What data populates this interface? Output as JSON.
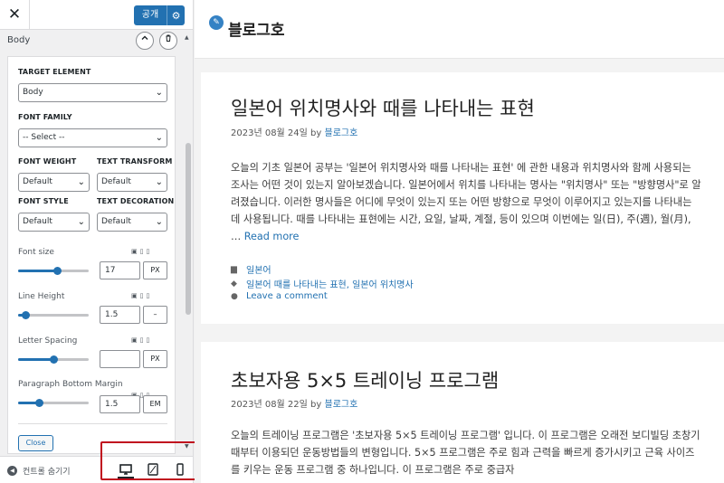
{
  "sidebar": {
    "close_glyph": "✕",
    "publish_label": "공개",
    "section_title": "Body",
    "target_element_label": "TARGET ELEMENT",
    "target_element_value": "Body",
    "font_family_label": "FONT FAMILY",
    "font_family_value": "-- Select --",
    "font_weight_label": "FONT WEIGHT",
    "font_weight_value": "Default",
    "text_transform_label": "TEXT TRANSFORM",
    "text_transform_value": "Default",
    "font_style_label": "FONT STYLE",
    "font_style_value": "Default",
    "text_decoration_label": "TEXT DECORATION",
    "text_decoration_value": "Default",
    "font_size": {
      "label": "Font size",
      "value": "17",
      "unit": "PX",
      "slider_level": 0.55
    },
    "line_height": {
      "label": "Line Height",
      "value": "1.5",
      "unit": "–",
      "slider_level": 0.1
    },
    "letter_spacing": {
      "label": "Letter Spacing",
      "value": "",
      "unit": "PX",
      "slider_level": 0.5
    },
    "paragraph_margin": {
      "label": "Paragraph Bottom Margin",
      "value": "1.5",
      "unit": "EM",
      "slider_level": 0.3
    },
    "close_label": "Close",
    "collapse_label": "컨트롤 숨기기",
    "accent_color": "#2271b1"
  },
  "site": {
    "title": "블로그호"
  },
  "posts": [
    {
      "title": "일본어 위치명사와 때를 나타내는 표현",
      "date": "2023년 08월 24일",
      "by": "by",
      "author": "블로그호",
      "excerpt": "오늘의 기초 일본어 공부는 '일본어 위치명사와 때를 나타내는 표현' 에 관한 내용과 위치명사와 함께 사용되는 조사는 어떤 것이 있는지 알아보겠습니다. 일본어에서 위치를 나타내는 명사는 \"위치명사\" 또는 \"방향명사\"로 알려졌습니다. 이러한 명사들은 어디에 무엇이 있는지 또는 어떤 방향으로 무엇이 이루어지고 있는지를 나타내는 데 사용됩니다. 때를 나타내는 표현에는 시간, 요일, 날짜, 계절, 등이 있으며 이번에는 일(日), 주(週), 월(月), …",
      "read_more": "Read more",
      "category": "일본어",
      "tags": "일본어 때를 나타내는 표현, 일본어 위치명사",
      "comment": "Leave a comment"
    },
    {
      "title": "초보자용 5×5 트레이닝 프로그램",
      "date": "2023년 08월 22일",
      "by": "by",
      "author": "블로그호",
      "excerpt": "오늘의 트레이닝 프로그램은 '초보자용 5×5 트레이닝 프로그램' 입니다. 이 프로그램은 오래전 보디빌딩 초창기 때부터 이용되던 운동방법들의 변형입니다. 5×5 프로그램은 주로 힘과 근력을 빠르게 증가시키고 근육 사이즈를 키우는 운동 프로그램 중 하나입니다. 이 프로그램은 주로 중급자"
    }
  ]
}
